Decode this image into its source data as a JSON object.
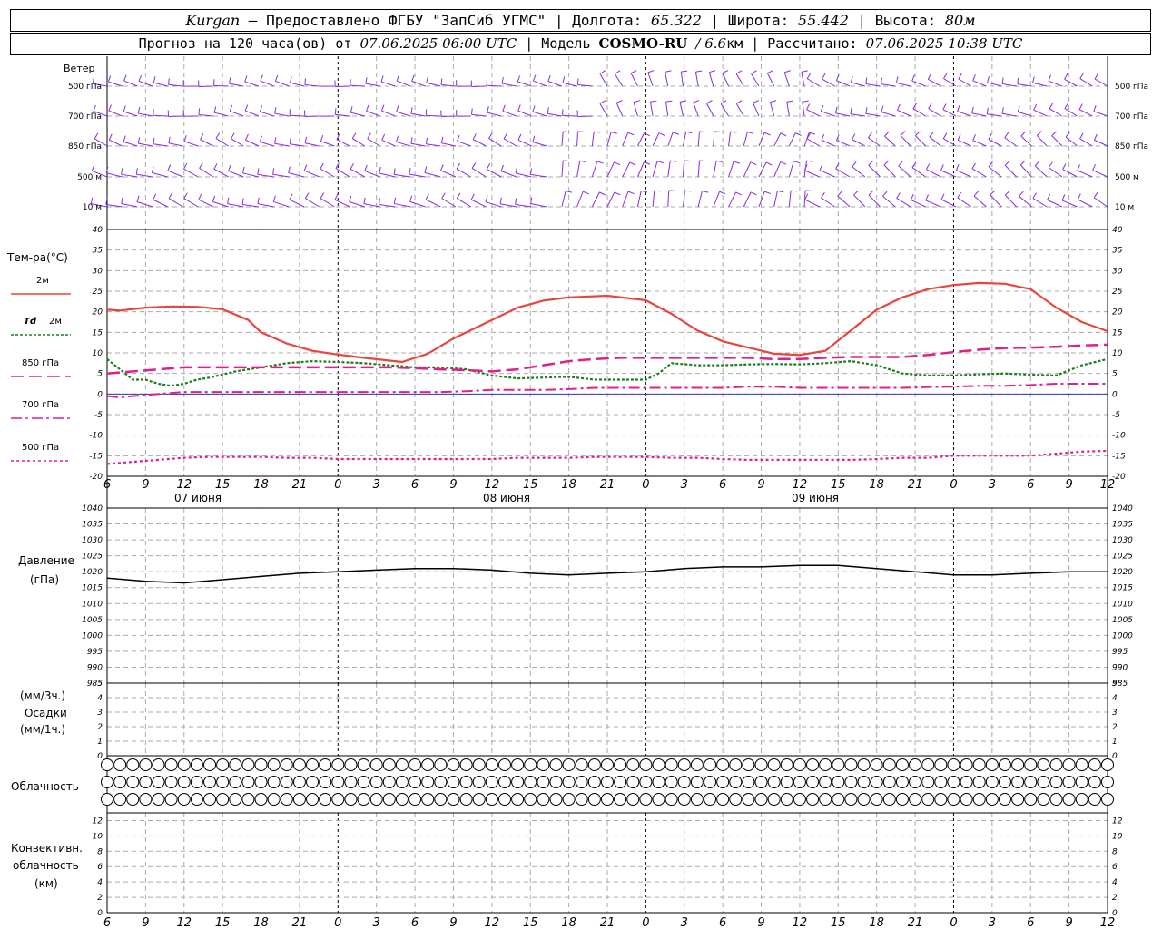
{
  "header": {
    "city": "Kurgan",
    "provider": "— Предоставлено ФГБУ \"ЗапСиб УГМС\" |",
    "lon_label": "Долгота:",
    "lon": "65.322",
    "lat_label": "| Широта:",
    "lat": "55.442",
    "alt_label": "| Высота:",
    "alt": "80м",
    "forecast_label": "Прогноз на 120 часа(ов) от",
    "forecast_start": "07.06.2025 06:00 UTC",
    "model_label": "| Модель",
    "model": "COSMO-RU",
    "resolution": "/ 6.6",
    "resolution_unit": "км",
    "calc_label": "| Рассчитано:",
    "calc_time": "07.06.2025 10:38 UTC"
  },
  "wind": {
    "title": "Ветер",
    "levels": [
      "500 гПа",
      "700 гПа",
      "850 гПа",
      "500 м",
      "10 м"
    ]
  },
  "temp": {
    "title": "Тем-ра(°С)",
    "legend": [
      {
        "label": "2м",
        "italic": "",
        "color": "#e8453c",
        "dash": ""
      },
      {
        "label": "2м",
        "italic": "Td",
        "color": "#1e7d1e",
        "dash": "3,2"
      },
      {
        "label": "850 гПа",
        "italic": "",
        "color": "#e0208a",
        "dash": "14,6"
      },
      {
        "label": "700 гПа",
        "italic": "",
        "color": "#e0208a",
        "dash": "12,4,3,4"
      },
      {
        "label": "500 гПа",
        "italic": "",
        "color": "#e0208a",
        "dash": "3,3"
      }
    ]
  },
  "pressure": {
    "title": "Давление",
    "unit": "(гПа)"
  },
  "precip": {
    "unit3": "(мм/3ч.)",
    "title": "Осадки",
    "unit1": "(мм/1ч.)"
  },
  "clouds": {
    "title": "Облачность"
  },
  "conv": {
    "title1": "Конвективн.",
    "title2": "облачность",
    "unit": "(км)"
  },
  "days": [
    "07 июня",
    "08 июня",
    "09 июня"
  ],
  "colors": {
    "wind": "#8a2be2",
    "t2m": "#e8453c",
    "td": "#1e7d1e",
    "t850": "#e0208a",
    "t700": "#e0208a",
    "t500": "#e0208a",
    "zero": "#3333cc",
    "pressure": "#000000",
    "grid": "#aaaaaa"
  },
  "chart_data": [
    {
      "type": "line",
      "name": "temperature",
      "x_hours_from_start": [
        0,
        3,
        6,
        9,
        12,
        15,
        18,
        21,
        24,
        27,
        30,
        33,
        36,
        39,
        42,
        45,
        48,
        51,
        54,
        57,
        60,
        63,
        66,
        69,
        72,
        75,
        78
      ],
      "x_tick_labels": [
        "6",
        "9",
        "12",
        "15",
        "18",
        "21",
        "0",
        "3",
        "6",
        "9",
        "12",
        "15",
        "18",
        "21",
        "0",
        "3",
        "6",
        "9",
        "12",
        "15",
        "18",
        "21",
        "0",
        "3",
        "6",
        "9",
        "12"
      ],
      "ylim": [
        -20,
        40
      ],
      "y_ticks": [
        -20,
        -15,
        -10,
        -5,
        0,
        5,
        10,
        15,
        20,
        25,
        30,
        35,
        40
      ],
      "series": [
        {
          "name": "2м",
          "key": "t2m",
          "x": [
            0,
            1,
            3,
            5,
            7,
            9,
            11,
            12,
            14,
            16,
            18,
            20,
            23,
            25,
            27,
            30,
            32,
            34,
            36,
            39,
            42,
            44,
            46,
            48,
            50,
            52,
            54,
            56,
            58,
            60,
            62,
            64,
            66,
            68,
            70,
            72,
            74,
            76,
            78
          ],
          "values": [
            20.5,
            20.3,
            21,
            21.3,
            21.2,
            20.6,
            18,
            15,
            12.3,
            10.5,
            9.6,
            8.8,
            7.8,
            9.8,
            13.5,
            18,
            21,
            22.7,
            23.5,
            23.9,
            22.8,
            19.5,
            15.5,
            12.8,
            11.3,
            9.8,
            9.5,
            10.5,
            15.5,
            20.5,
            23.5,
            25.5,
            26.5,
            27,
            26.8,
            25.5,
            21,
            17.5,
            15.3
          ]
        },
        {
          "name": "Td 2м",
          "key": "td",
          "x": [
            0,
            1,
            2,
            3,
            4,
            5,
            6,
            7,
            8,
            10,
            12,
            14,
            16,
            18,
            20,
            22,
            24,
            26,
            28,
            30,
            32,
            34,
            36,
            38,
            40,
            42,
            43,
            44,
            46,
            48,
            50,
            52,
            54,
            56,
            58,
            60,
            62,
            64,
            66,
            68,
            70,
            72,
            74,
            76,
            78
          ],
          "values": [
            8.5,
            6,
            3.5,
            3.5,
            2.5,
            2,
            2.5,
            3.5,
            4,
            5.5,
            6.5,
            7.5,
            8,
            7.8,
            7.5,
            7,
            6.5,
            6.5,
            6,
            4.5,
            3.8,
            4,
            4.2,
            3.5,
            3.5,
            3.5,
            5,
            7.5,
            7,
            7,
            7.2,
            7.3,
            7.2,
            7.5,
            8,
            7,
            5,
            4.5,
            4.5,
            4.8,
            5,
            4.7,
            4.5,
            7,
            8.5
          ]
        },
        {
          "name": "850 гПа",
          "key": "t850",
          "x": [
            0,
            2,
            4,
            6,
            8,
            10,
            12,
            14,
            16,
            18,
            20,
            22,
            24,
            26,
            28,
            30,
            32,
            34,
            36,
            38,
            40,
            42,
            44,
            46,
            48,
            50,
            52,
            54,
            56,
            58,
            60,
            62,
            64,
            66,
            68,
            70,
            72,
            74,
            76,
            78
          ],
          "values": [
            5,
            5.5,
            6,
            6.5,
            6.5,
            6.5,
            6.5,
            6.5,
            6.5,
            6.5,
            6.5,
            6.5,
            6.3,
            6,
            5.8,
            5.5,
            6,
            7,
            8,
            8.5,
            8.8,
            8.8,
            8.8,
            8.8,
            8.8,
            8.8,
            8.5,
            8.5,
            8.8,
            9,
            9,
            9,
            9.5,
            10.2,
            10.8,
            11.2,
            11.3,
            11.5,
            11.8,
            12
          ]
        },
        {
          "name": "700 гПа",
          "key": "t700",
          "x": [
            0,
            1,
            2,
            4,
            6,
            8,
            10,
            12,
            14,
            16,
            18,
            20,
            22,
            24,
            26,
            28,
            30,
            32,
            34,
            36,
            38,
            40,
            42,
            44,
            46,
            48,
            50,
            52,
            54,
            56,
            58,
            60,
            62,
            64,
            66,
            68,
            70,
            72,
            74,
            76,
            78
          ],
          "values": [
            -0.5,
            -0.8,
            -0.5,
            0,
            0.5,
            0.5,
            0.5,
            0.5,
            0.5,
            0.5,
            0.5,
            0.5,
            0.5,
            0.5,
            0.5,
            0.7,
            1,
            1,
            1,
            1.2,
            1.5,
            1.5,
            1.5,
            1.5,
            1.5,
            1.5,
            1.8,
            1.8,
            1.5,
            1.5,
            1.5,
            1.5,
            1.5,
            1.7,
            1.8,
            2,
            2,
            2.2,
            2.5,
            2.5,
            2.5
          ]
        },
        {
          "name": "500 гПа",
          "key": "t500",
          "x": [
            0,
            2,
            4,
            6,
            8,
            10,
            12,
            14,
            16,
            18,
            20,
            22,
            24,
            26,
            28,
            30,
            32,
            34,
            36,
            38,
            40,
            42,
            44,
            46,
            48,
            50,
            52,
            54,
            56,
            58,
            60,
            62,
            64,
            66,
            68,
            70,
            72,
            74,
            76,
            78
          ],
          "values": [
            -17,
            -16.5,
            -16,
            -15.5,
            -15.3,
            -15.3,
            -15.3,
            -15.5,
            -15.5,
            -15.8,
            -15.8,
            -15.8,
            -15.8,
            -15.8,
            -15.8,
            -15.8,
            -15.5,
            -15.5,
            -15.5,
            -15.3,
            -15.3,
            -15.3,
            -15.5,
            -15.5,
            -15.8,
            -16,
            -16,
            -16,
            -16,
            -16,
            -15.8,
            -15.5,
            -15.5,
            -15,
            -15,
            -15,
            -15,
            -14.5,
            -14,
            -13.8
          ]
        }
      ]
    },
    {
      "type": "line",
      "name": "pressure",
      "ylim": [
        985,
        1040
      ],
      "y_ticks": [
        985,
        990,
        995,
        1000,
        1005,
        1010,
        1015,
        1020,
        1025,
        1030,
        1035,
        1040
      ],
      "series": [
        {
          "name": "Давление",
          "key": "pressure",
          "x": [
            0,
            3,
            6,
            9,
            12,
            15,
            18,
            21,
            24,
            27,
            30,
            33,
            36,
            39,
            42,
            45,
            48,
            51,
            54,
            57,
            60,
            63,
            66,
            69,
            72,
            75,
            78
          ],
          "values": [
            1018,
            1017,
            1016.5,
            1017.5,
            1018.5,
            1019.5,
            1020,
            1020.5,
            1021,
            1021,
            1020.5,
            1019.5,
            1019,
            1019.5,
            1020,
            1021,
            1021.5,
            1021.5,
            1022,
            1022,
            1021,
            1020,
            1019,
            1019,
            1019.5,
            1020,
            1020
          ]
        }
      ]
    },
    {
      "type": "line",
      "name": "precipitation",
      "ylim": [
        0,
        5
      ],
      "y_ticks": [
        0,
        1,
        2,
        3,
        4,
        5
      ],
      "series": []
    },
    {
      "type": "line",
      "name": "convective cloud",
      "ylim": [
        0,
        13
      ],
      "y_ticks": [
        0,
        2,
        4,
        6,
        8,
        10,
        12
      ],
      "series": []
    }
  ]
}
